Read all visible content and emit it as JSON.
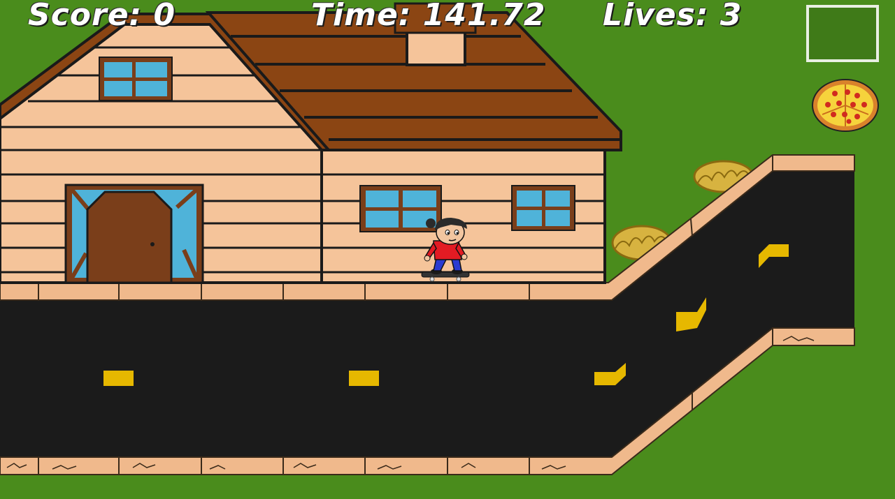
{
  "hud": {
    "score_label": "Score:",
    "score_value": "0",
    "time_label": "Time:",
    "time_value": "141.72",
    "lives_label": "Lives:",
    "lives_value": "3"
  },
  "scene": {
    "item_slot_contents": "empty",
    "pickup": "pizza",
    "player": "skateboarder"
  },
  "colors": {
    "grass": "#4a8c1c",
    "road": "#1b1b1b",
    "road_marking": "#e6b800",
    "house_siding": "#f5c49a",
    "roof": "#8b4513",
    "window_glass": "#4fb3d9",
    "door": "#7a3e1a",
    "sidewalk": "#f0b98c"
  }
}
